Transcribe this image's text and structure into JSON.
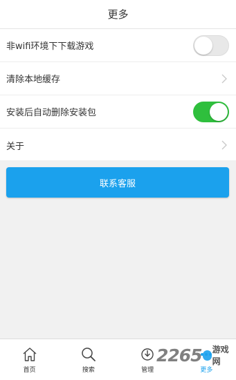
{
  "header": {
    "title": "更多"
  },
  "settings": {
    "items": [
      {
        "label": "非wifi环境下下载游戏",
        "control": "toggle",
        "state": "off"
      },
      {
        "label": "清除本地缓存",
        "control": "chevron"
      },
      {
        "label": "安装后自动删除安装包",
        "control": "toggle",
        "state": "on"
      },
      {
        "label": "关于",
        "control": "chevron"
      }
    ]
  },
  "contact_button": {
    "label": "联系客服"
  },
  "bottom_nav": {
    "items": [
      {
        "label": "首页",
        "icon": "home-icon"
      },
      {
        "label": "搜索",
        "icon": "search-icon"
      },
      {
        "label": "管理",
        "icon": "manage-icon"
      },
      {
        "label": "更多",
        "icon": "more-icon",
        "active": true
      }
    ]
  },
  "watermark": {
    "number": "2265",
    "text": "游戏网"
  },
  "colors": {
    "accent": "#1ba1ed",
    "toggle_on": "#2fbf3d",
    "toggle_off": "#e8e8e8",
    "background": "#f1f1f1"
  }
}
